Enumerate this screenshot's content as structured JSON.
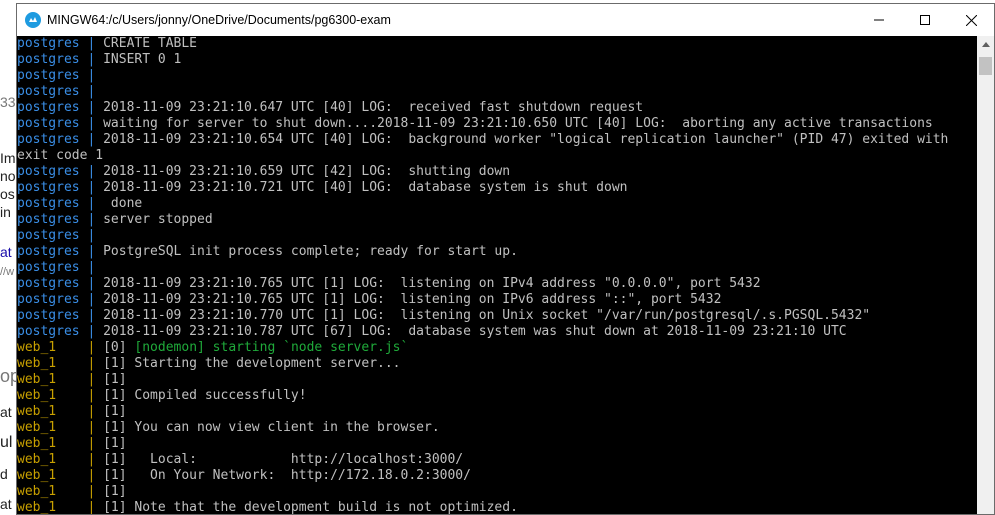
{
  "background_page": {
    "fragments": [
      "33",
      "Im",
      "no",
      "os",
      "in",
      "at",
      "//w",
      "op",
      "at",
      "ul",
      "d",
      "at"
    ]
  },
  "window": {
    "title": "MINGW64:/c/Users/jonny/OneDrive/Documents/pg6300-exam",
    "icon": "mingw-app-icon"
  },
  "terminal": {
    "lines": [
      {
        "prefix": "postgres | ",
        "kind": "pg",
        "text": "CREATE TABLE"
      },
      {
        "prefix": "postgres | ",
        "kind": "pg",
        "text": "INSERT 0 1"
      },
      {
        "prefix": "postgres | ",
        "kind": "pg",
        "text": ""
      },
      {
        "prefix": "postgres | ",
        "kind": "pg",
        "text": ""
      },
      {
        "prefix": "postgres | ",
        "kind": "pg",
        "text": "2018-11-09 23:21:10.647 UTC [40] LOG:  received fast shutdown request"
      },
      {
        "prefix": "postgres | ",
        "kind": "pg",
        "text": "waiting for server to shut down....2018-11-09 23:21:10.650 UTC [40] LOG:  aborting any active transactions"
      },
      {
        "prefix": "postgres | ",
        "kind": "pg",
        "text": "2018-11-09 23:21:10.654 UTC [40] LOG:  background worker \"logical replication launcher\" (PID 47) exited with"
      },
      {
        "prefix": "",
        "kind": "plain",
        "text": "exit code 1"
      },
      {
        "prefix": "postgres | ",
        "kind": "pg",
        "text": "2018-11-09 23:21:10.659 UTC [42] LOG:  shutting down"
      },
      {
        "prefix": "postgres | ",
        "kind": "pg",
        "text": "2018-11-09 23:21:10.721 UTC [40] LOG:  database system is shut down"
      },
      {
        "prefix": "postgres | ",
        "kind": "pg",
        "text": " done"
      },
      {
        "prefix": "postgres | ",
        "kind": "pg",
        "text": "server stopped"
      },
      {
        "prefix": "postgres | ",
        "kind": "pg",
        "text": ""
      },
      {
        "prefix": "postgres | ",
        "kind": "pg",
        "text": "PostgreSQL init process complete; ready for start up."
      },
      {
        "prefix": "postgres | ",
        "kind": "pg",
        "text": ""
      },
      {
        "prefix": "postgres | ",
        "kind": "pg",
        "text": "2018-11-09 23:21:10.765 UTC [1] LOG:  listening on IPv4 address \"0.0.0.0\", port 5432"
      },
      {
        "prefix": "postgres | ",
        "kind": "pg",
        "text": "2018-11-09 23:21:10.765 UTC [1] LOG:  listening on IPv6 address \"::\", port 5432"
      },
      {
        "prefix": "postgres | ",
        "kind": "pg",
        "text": "2018-11-09 23:21:10.770 UTC [1] LOG:  listening on Unix socket \"/var/run/postgresql/.s.PGSQL.5432\""
      },
      {
        "prefix": "postgres | ",
        "kind": "pg",
        "text": "2018-11-09 23:21:10.787 UTC [67] LOG:  database system was shut down at 2018-11-09 23:21:10 UTC"
      },
      {
        "prefix": "web_1    | ",
        "kind": "web",
        "text": "[0] ",
        "extra": "[nodemon] starting `node server.js`"
      },
      {
        "prefix": "web_1    | ",
        "kind": "web",
        "text": "[1] Starting the development server..."
      },
      {
        "prefix": "web_1    | ",
        "kind": "web",
        "text": "[1]"
      },
      {
        "prefix": "web_1    | ",
        "kind": "web",
        "text": "[1] Compiled successfully!"
      },
      {
        "prefix": "web_1    | ",
        "kind": "web",
        "text": "[1]"
      },
      {
        "prefix": "web_1    | ",
        "kind": "web",
        "text": "[1] You can now view client in the browser."
      },
      {
        "prefix": "web_1    | ",
        "kind": "web",
        "text": "[1]"
      },
      {
        "prefix": "web_1    | ",
        "kind": "web",
        "text": "[1]   Local:            http://localhost:3000/"
      },
      {
        "prefix": "web_1    | ",
        "kind": "web",
        "text": "[1]   On Your Network:  http://172.18.0.2:3000/"
      },
      {
        "prefix": "web_1    | ",
        "kind": "web",
        "text": "[1]"
      },
      {
        "prefix": "web_1    | ",
        "kind": "web",
        "text": "[1] Note that the development build is not optimized."
      }
    ]
  },
  "colors": {
    "postgres_prefix": "#3a8ee6",
    "web_prefix": "#c8a000",
    "nodemon": "#1faa3a",
    "terminal_bg": "#000000",
    "terminal_text": "#c0c0c0"
  }
}
